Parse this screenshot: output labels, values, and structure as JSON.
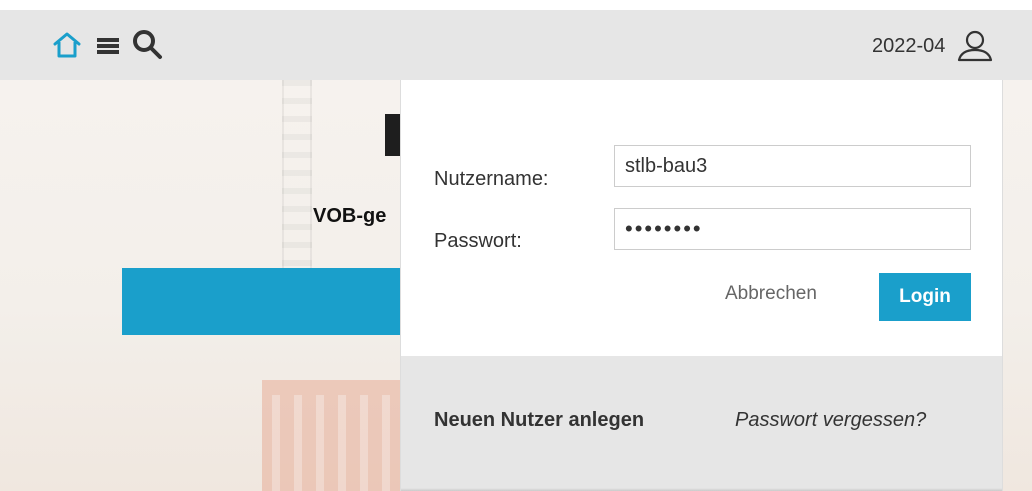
{
  "header": {
    "date_label": "2022-04",
    "icons": {
      "home": "home-icon",
      "menu": "menu-icon",
      "search": "search-icon",
      "user": "user-icon"
    },
    "colors": {
      "accent": "#1a9fcb",
      "bar": "#e6e6e6"
    }
  },
  "hero": {
    "tagline": "VOB-ge"
  },
  "login": {
    "username_label": "Nutzername:",
    "username_value": "stlb-bau3",
    "password_label": "Passwort:",
    "password_value": "••••••••",
    "cancel_label": "Abbrechen",
    "login_label": "Login",
    "new_user_label": "Neuen Nutzer anlegen",
    "forgot_label": "Passwort vergessen?"
  }
}
